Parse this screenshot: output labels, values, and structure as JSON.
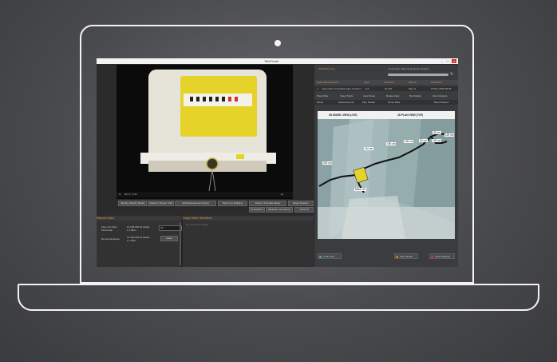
{
  "window": {
    "title": "TelePortal"
  },
  "video_controls": {
    "time": "00:17 / 0:34"
  },
  "buttons_row1": [
    "Identify (Attach) Media",
    "Capture \"Screen\" Tab",
    "Add Measurement (Auto)",
    "Start Line Drawing",
    "Detect / Annotate Meter",
    "Begin Session"
  ],
  "buttons_row2": [
    "Screenshot",
    "Measure Line (Auto)",
    "Clear All"
  ],
  "network": {
    "title": "Network Users",
    "users": [
      {
        "name": "Fitter (On Site)",
        "role": "Technician",
        "address": "10.168.200.19 (Data)",
        "speed": "1.1 Mb/s",
        "status": "Ok"
      },
      {
        "name": "Remote Engineer",
        "role": "",
        "address": "10.168.200.42 (Data)",
        "speed": "1.1 Mb/s",
        "status": "Leave"
      }
    ]
  },
  "detections": {
    "title": "Gauge Meter Detections",
    "placeholder": "No detections logged"
  },
  "right": {
    "tab_a": "3D Model (Live)",
    "tab_b": "Connection: Remote Engineer Session",
    "header_row": [
      "Status",
      "Measurement",
      "Type",
      "Distance",
      "Start Pt",
      "Date/Time"
    ],
    "data_row": [
      "Gas meter connection pipe, branch 1",
      "G4",
      "#1 201",
      "Pipe G",
      "15 Nov 2018 09:33"
    ],
    "tool_row": [
      "Show Pipe",
      "Snap Points",
      "Auto Route",
      "Rotate View",
      "Pan Model",
      "Zoom Extents"
    ],
    "tab_row": [
      "Model",
      "Measurements",
      "Pipe Details",
      "Route Data",
      "",
      "Export Report"
    ],
    "view_tabs": [
      "3D MODEL VIEW (LIVE)",
      "2D PLAN VIEW (TOP)"
    ],
    "pipe_labels": [
      "110 cm",
      "200 cm",
      "190 cm",
      "100 cm",
      "50 cm",
      "40 cm",
      "120 cm",
      "120 cm",
      "Meter 33"
    ],
    "bottom_buttons": [
      "Undo Last",
      "Save Model",
      "Close Session"
    ]
  },
  "colors": {
    "accent": "#d89a4d",
    "meter_yellow": "#e6d32a",
    "close_red": "#d9382f"
  }
}
